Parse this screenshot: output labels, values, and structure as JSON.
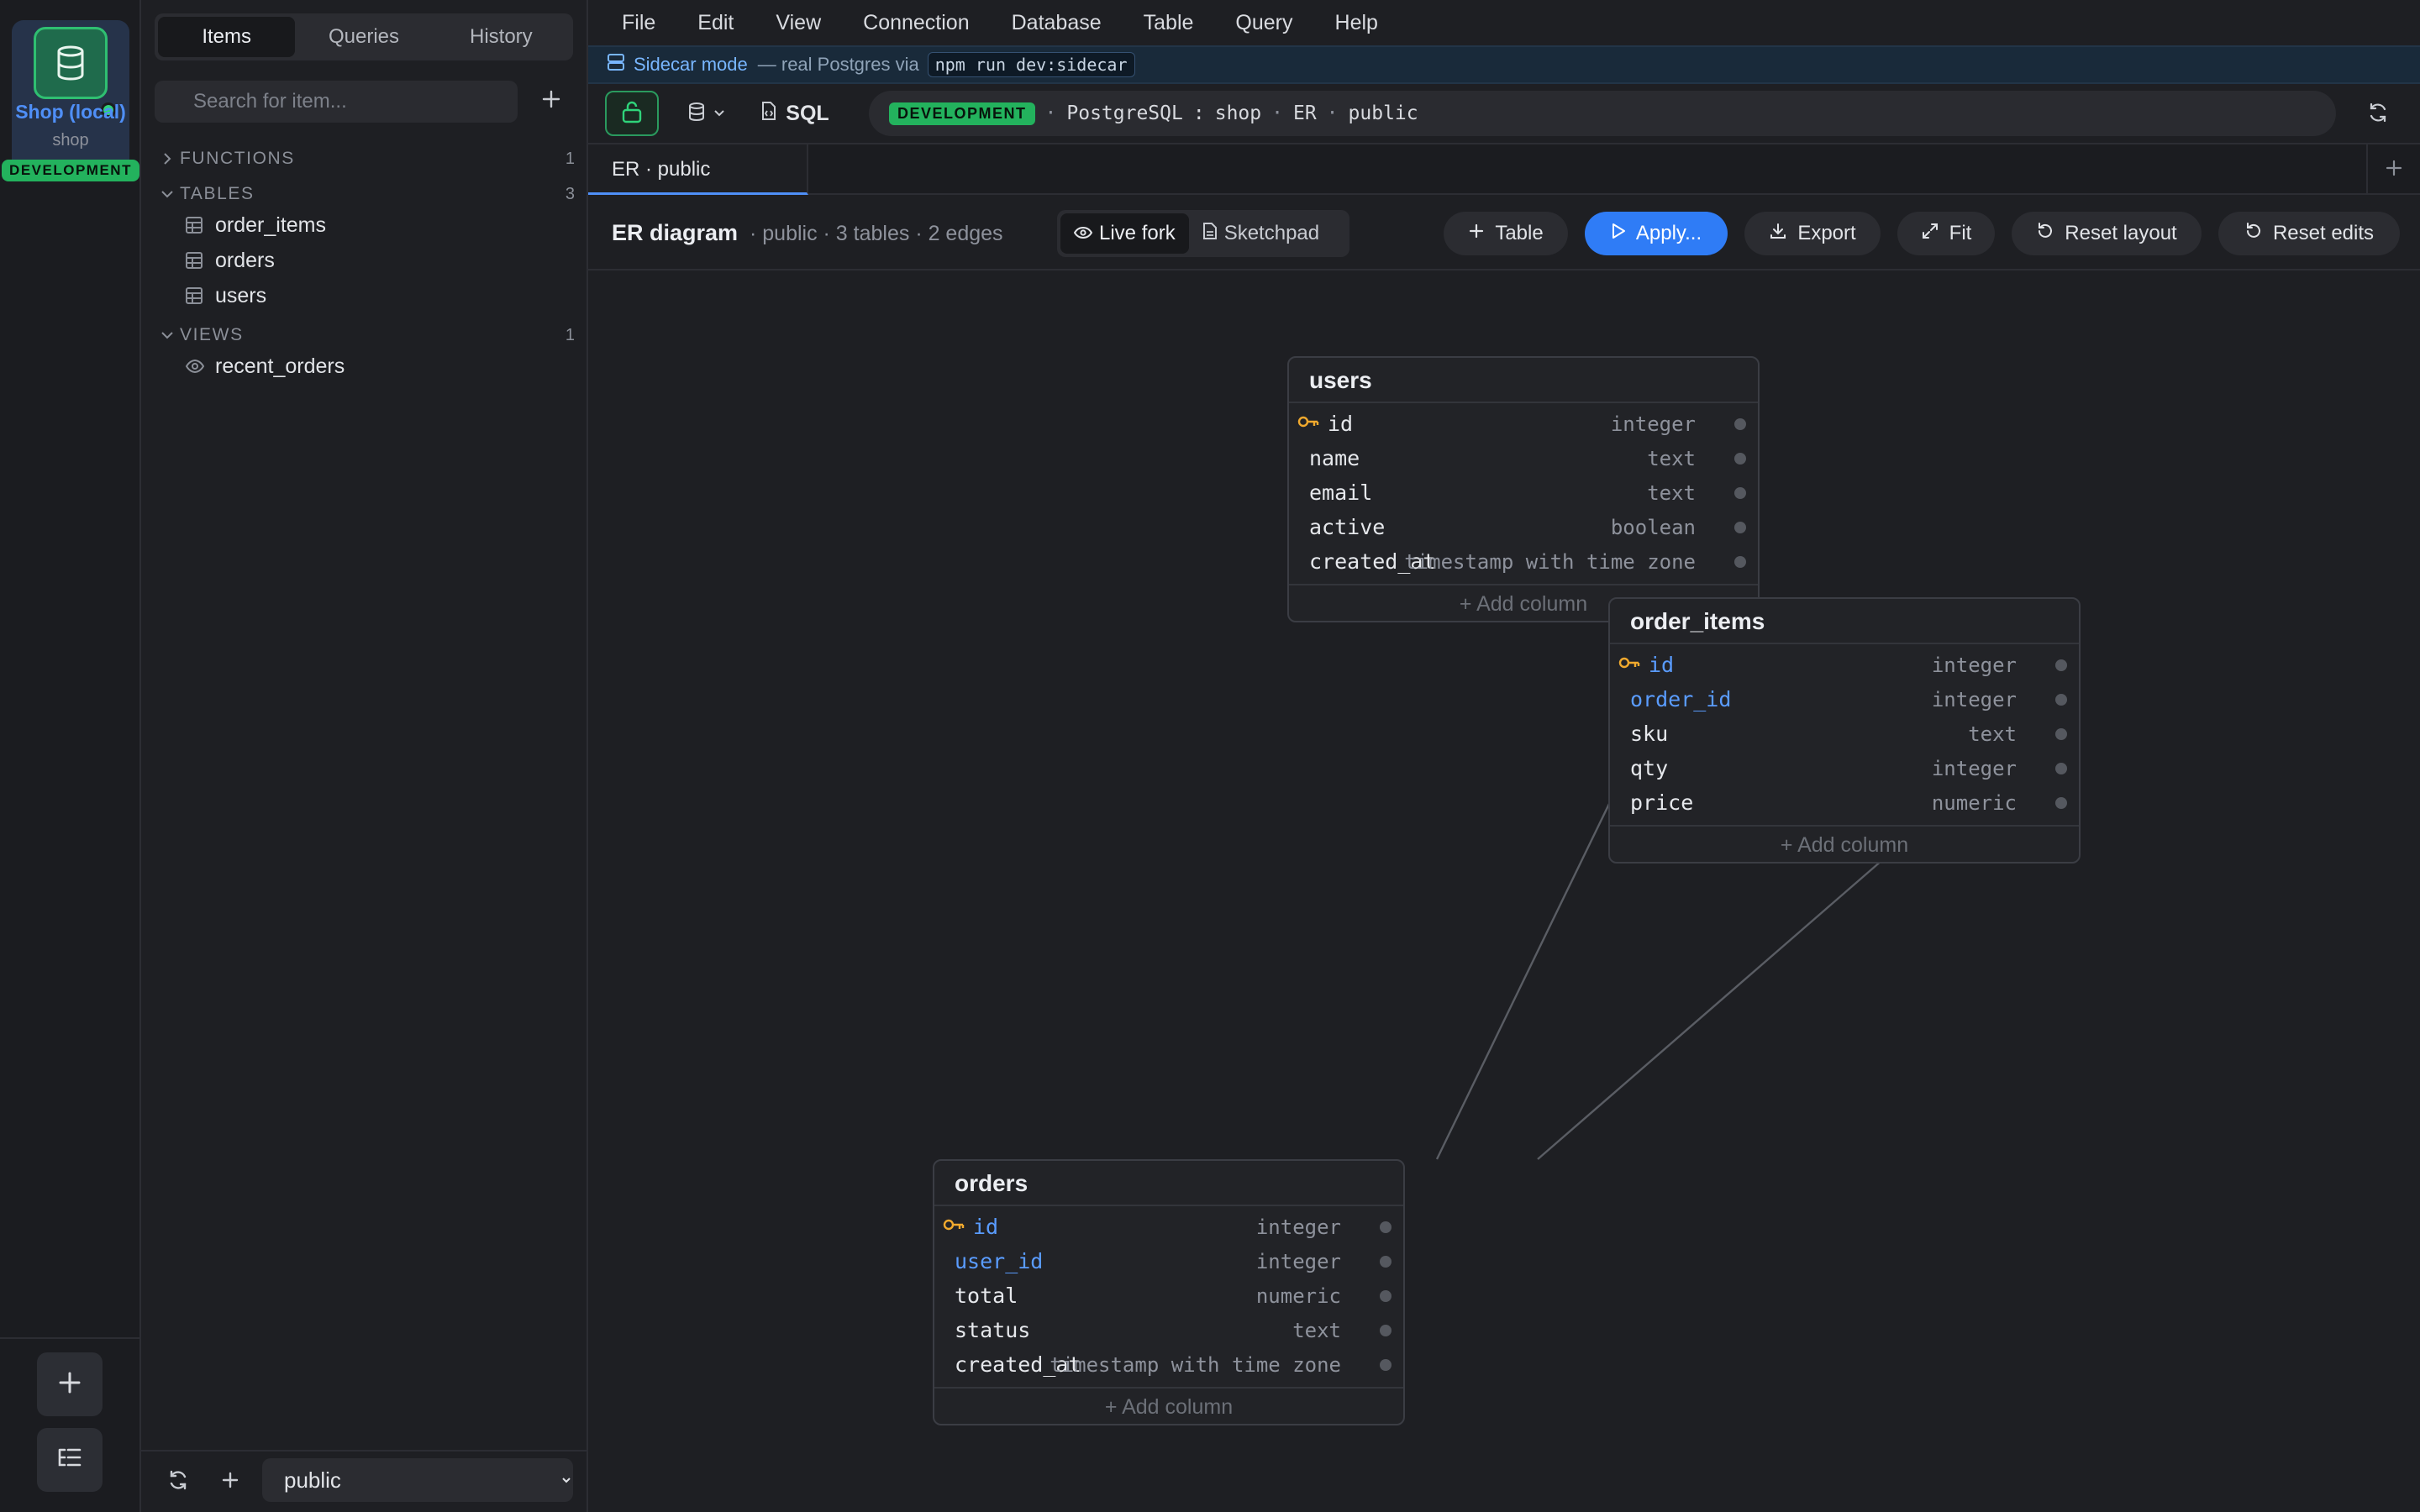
{
  "connection": {
    "name": "Shop (local)",
    "database": "shop",
    "env": "DEVELOPMENT",
    "status_color": "#2fd37a"
  },
  "sidebar": {
    "tabs": [
      "Items",
      "Queries",
      "History"
    ],
    "active_tab": "Items",
    "search_placeholder": "Search for item...",
    "groups": {
      "functions": {
        "label": "FUNCTIONS",
        "count": "1"
      },
      "tables": {
        "label": "TABLES",
        "count": "3",
        "items": [
          "order_items",
          "orders",
          "users"
        ]
      },
      "views": {
        "label": "VIEWS",
        "count": "1",
        "items": [
          "recent_orders"
        ]
      }
    },
    "schema": "public"
  },
  "menubar": [
    "File",
    "Edit",
    "View",
    "Connection",
    "Database",
    "Table",
    "Query",
    "Help"
  ],
  "sidecar": {
    "title": "Sidecar mode",
    "note": "— real Postgres via",
    "command": "npm run dev:sidecar"
  },
  "toolbar": {
    "sql_label": "SQL",
    "breadcrumb": {
      "env": "DEVELOPMENT",
      "engine": "PostgreSQL",
      "sep": ":",
      "db": "shop",
      "view": "ER",
      "schema": "public"
    }
  },
  "tabs": {
    "active": "ER · public"
  },
  "er": {
    "title": "ER diagram",
    "meta": "· public · 3 tables · 2 edges",
    "modes": [
      "Live fork",
      "Sketchpad"
    ],
    "active_mode": "Live fork",
    "buttons": {
      "table": "Table",
      "apply": "Apply...",
      "export": "Export",
      "fit": "Fit",
      "reset_layout": "Reset layout",
      "reset_edits": "Reset edits"
    },
    "add_column_label": "+ Add column",
    "tables": {
      "users": {
        "name": "users",
        "columns": [
          {
            "name": "id",
            "type": "integer",
            "pk": true,
            "fk": false
          },
          {
            "name": "name",
            "type": "text",
            "pk": false,
            "fk": false
          },
          {
            "name": "email",
            "type": "text",
            "pk": false,
            "fk": false
          },
          {
            "name": "active",
            "type": "boolean",
            "pk": false,
            "fk": false
          },
          {
            "name": "created_at",
            "type": "timestamp with time zone",
            "pk": false,
            "fk": false
          }
        ]
      },
      "order_items": {
        "name": "order_items",
        "columns": [
          {
            "name": "id",
            "type": "integer",
            "pk": true,
            "fk": true
          },
          {
            "name": "order_id",
            "type": "integer",
            "pk": false,
            "fk": true
          },
          {
            "name": "sku",
            "type": "text",
            "pk": false,
            "fk": false
          },
          {
            "name": "qty",
            "type": "integer",
            "pk": false,
            "fk": false
          },
          {
            "name": "price",
            "type": "numeric",
            "pk": false,
            "fk": false
          }
        ]
      },
      "orders": {
        "name": "orders",
        "columns": [
          {
            "name": "id",
            "type": "integer",
            "pk": true,
            "fk": true
          },
          {
            "name": "user_id",
            "type": "integer",
            "pk": false,
            "fk": true
          },
          {
            "name": "total",
            "type": "numeric",
            "pk": false,
            "fk": false
          },
          {
            "name": "status",
            "type": "text",
            "pk": false,
            "fk": false
          },
          {
            "name": "created_at",
            "type": "timestamp with time zone",
            "pk": false,
            "fk": false
          }
        ]
      }
    },
    "edges": [
      {
        "from": "orders",
        "to": "users"
      },
      {
        "from": "orders",
        "to": "order_items"
      }
    ]
  },
  "colors": {
    "accent": "#2f7cf6",
    "fk": "#5a9cff",
    "pk_key": "#f0a92e",
    "env_badge": "#23b25d"
  }
}
